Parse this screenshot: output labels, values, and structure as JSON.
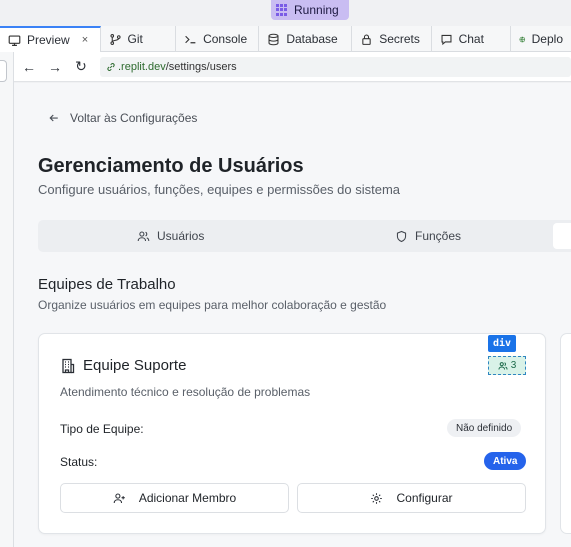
{
  "status": {
    "label": "Running"
  },
  "tabs": [
    {
      "label": "Preview",
      "close": "×"
    },
    {
      "label": "Git"
    },
    {
      "label": "Console"
    },
    {
      "label": "Database"
    },
    {
      "label": "Secrets"
    },
    {
      "label": "Chat"
    },
    {
      "label": "Deplo"
    }
  ],
  "browser": {
    "url_host": ".replit.dev",
    "url_path": "/settings/users"
  },
  "page": {
    "back_label": "Voltar às Configurações",
    "title": "Gerenciamento de Usuários",
    "subtitle": "Configure usuários, funções, equipes e permissões do sistema",
    "tabs": [
      {
        "label": "Usuários"
      },
      {
        "label": "Funções"
      }
    ],
    "section": {
      "title": "Equipes de Trabalho",
      "subtitle": "Organize usuários em equipes para melhor colaboração e gestão"
    },
    "team": {
      "name": "Equipe Suporte",
      "description": "Atendimento técnico e resolução de problemas",
      "dev_tag": "div",
      "member_count": "3",
      "type_label": "Tipo de Equipe:",
      "type_value": "Não definido",
      "status_label": "Status:",
      "status_value": "Ativa",
      "add_member": "Adicionar Membro",
      "configure": "Configurar"
    }
  },
  "colors": {
    "accent": "#2563eb",
    "running_bg": "#c9bdf2",
    "members_bg": "#d9f2e8"
  }
}
